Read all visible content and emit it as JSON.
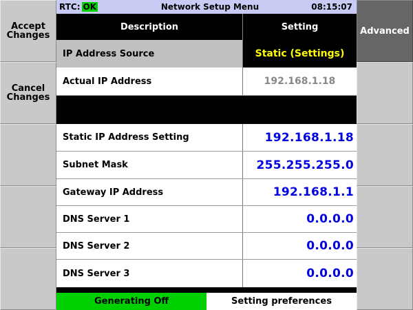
{
  "status_bar": {
    "rtc_label": "RTC:",
    "rtc_status": "OK",
    "title": "Network Setup Menu",
    "time": "08:15:07"
  },
  "left_buttons": [
    {
      "label": "Accept\nChanges"
    },
    {
      "label": "Cancel\nChanges"
    },
    {
      "label": ""
    },
    {
      "label": ""
    },
    {
      "label": ""
    }
  ],
  "right_buttons": [
    {
      "label": "Advanced"
    },
    {
      "label": ""
    },
    {
      "label": ""
    },
    {
      "label": ""
    },
    {
      "label": ""
    }
  ],
  "table": {
    "headers": {
      "description": "Description",
      "setting": "Setting"
    },
    "ip_source": {
      "label": "IP Address Source",
      "value": "Static (Settings)"
    },
    "actual_ip": {
      "label": "Actual IP Address",
      "value": "192.168.1.18"
    },
    "rows": [
      {
        "label": "Static IP Address Setting",
        "value": "192.168.1.18"
      },
      {
        "label": "Subnet Mask",
        "value": "255.255.255.0"
      },
      {
        "label": "Gateway IP Address",
        "value": "192.168.1.1"
      },
      {
        "label": "DNS Server 1",
        "value": "0.0.0.0"
      },
      {
        "label": "DNS Server 2",
        "value": "0.0.0.0"
      },
      {
        "label": "DNS Server 3",
        "value": "0.0.0.0"
      }
    ]
  },
  "bottom_bar": {
    "generating": "Generating Off",
    "preferences": "Setting preferences"
  },
  "colors": {
    "status_ok": "#00d000",
    "status_bar_bg": "#c8ccf5",
    "selected_value_text": "#ffff00",
    "value_text": "#0000e0",
    "generating_bg": "#00d000"
  }
}
